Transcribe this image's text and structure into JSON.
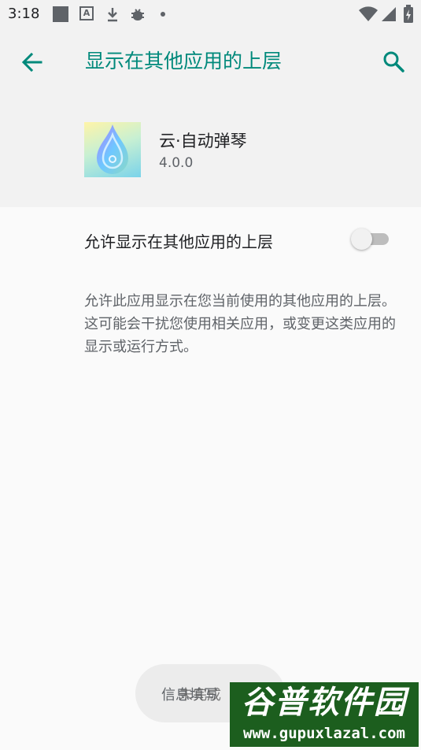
{
  "status_bar": {
    "time": "3:18",
    "left_icons": [
      "app-square-icon",
      "text-a-icon",
      "download-icon",
      "bug-icon",
      "dot-icon"
    ],
    "right_icons": [
      "wifi-icon",
      "signal-icon",
      "battery-icon"
    ]
  },
  "header": {
    "title": "显示在其他应用的上层",
    "accent_color": "#00897b"
  },
  "app": {
    "name": "云·自动弹琴",
    "version": "4.0.0"
  },
  "setting": {
    "label": "允许显示在其他应用的上层",
    "toggle_on": false
  },
  "description": "允许此应用显示在您当前使用的其他应用的上层。这可能会干扰您使用相关应用，或变更这类应用的显示或运行方式。",
  "toast": {
    "text_back": "信息填写",
    "text_front": "未完成"
  },
  "watermark": {
    "title": "谷普软件园",
    "url": "www.gupuxlazal.com"
  }
}
